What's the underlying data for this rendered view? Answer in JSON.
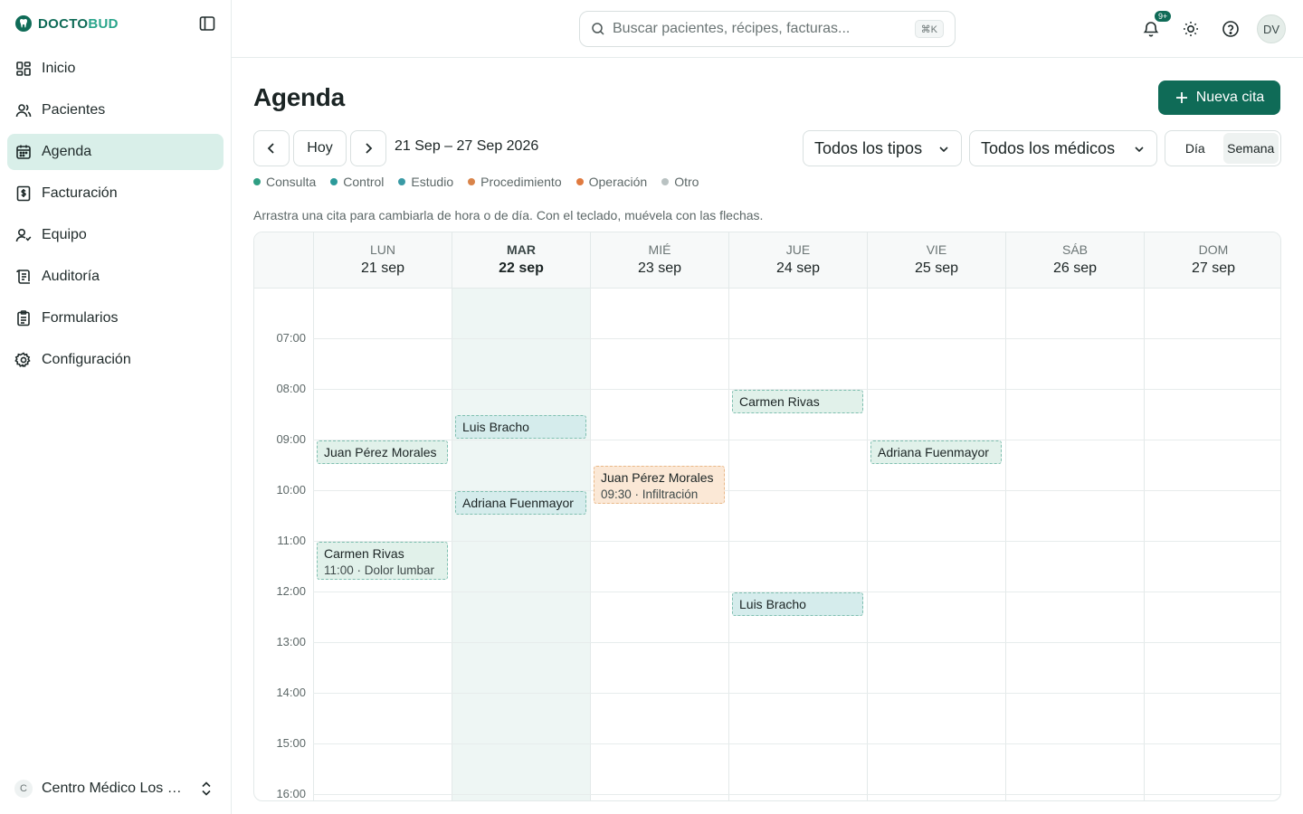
{
  "brand": {
    "name_a": "DOCTO",
    "name_b": "BUD"
  },
  "sidebar": {
    "items": [
      {
        "label": "Inicio",
        "icon": "dashboard-icon"
      },
      {
        "label": "Pacientes",
        "icon": "users-icon"
      },
      {
        "label": "Agenda",
        "icon": "calendar-icon",
        "active": true
      },
      {
        "label": "Facturación",
        "icon": "invoice-icon"
      },
      {
        "label": "Equipo",
        "icon": "team-icon"
      },
      {
        "label": "Auditoría",
        "icon": "audit-icon"
      },
      {
        "label": "Formularios",
        "icon": "forms-icon"
      },
      {
        "label": "Configuración",
        "icon": "settings-icon"
      }
    ],
    "org": {
      "initial": "C",
      "name": "Centro Médico Los O..."
    }
  },
  "topbar": {
    "search_placeholder": "Buscar pacientes, récipes, facturas...",
    "search_shortcut": "⌘K",
    "notifications_badge": "9+",
    "avatar_initials": "DV"
  },
  "page": {
    "title": "Agenda",
    "new_button": "Nueva cita",
    "today_button": "Hoy",
    "range": "21 Sep – 27 Sep 2026",
    "type_filter": "Todos los tipos",
    "doctor_filter": "Todos los médicos",
    "view_day": "Día",
    "view_week": "Semana",
    "hint": "Arrastra una cita para cambiarla de hora o de día. Con el teclado, muévela con las flechas."
  },
  "legend": [
    {
      "label": "Consulta",
      "color": "#2f9e83"
    },
    {
      "label": "Control",
      "color": "#2b9a9a"
    },
    {
      "label": "Estudio",
      "color": "#3a9aa5"
    },
    {
      "label": "Procedimiento",
      "color": "#d9844a"
    },
    {
      "label": "Operación",
      "color": "#e07a3f"
    },
    {
      "label": "Otro",
      "color": "#b9c2c2"
    }
  ],
  "calendar": {
    "days": [
      {
        "dow": "LUN",
        "date": "21 sep"
      },
      {
        "dow": "MAR",
        "date": "22 sep",
        "today": true
      },
      {
        "dow": "MIÉ",
        "date": "23 sep"
      },
      {
        "dow": "JUE",
        "date": "24 sep"
      },
      {
        "dow": "VIE",
        "date": "25 sep"
      },
      {
        "dow": "SÁB",
        "date": "26 sep"
      },
      {
        "dow": "DOM",
        "date": "27 sep"
      }
    ],
    "hours": [
      "07:00",
      "08:00",
      "09:00",
      "10:00",
      "11:00",
      "12:00",
      "13:00",
      "14:00",
      "15:00",
      "16:00"
    ],
    "appointments": [
      {
        "day": 0,
        "start": "09:00",
        "end": "09:30",
        "patient": "Juan Pérez Morales",
        "type": "consulta"
      },
      {
        "day": 0,
        "start": "11:00",
        "end": "11:45",
        "patient": "Carmen Rivas",
        "detail": "11:00 · Dolor lumbar",
        "type": "consulta"
      },
      {
        "day": 1,
        "start": "08:30",
        "end": "09:00",
        "patient": "Luis Bracho",
        "type": "control"
      },
      {
        "day": 1,
        "start": "10:00",
        "end": "10:30",
        "patient": "Adriana Fuenmayor",
        "type": "control"
      },
      {
        "day": 2,
        "start": "09:30",
        "end": "10:15",
        "patient": "Juan Pérez Morales",
        "detail": "09:30 · Infiltración",
        "type": "procedimiento"
      },
      {
        "day": 3,
        "start": "08:00",
        "end": "08:30",
        "patient": "Carmen Rivas",
        "type": "consulta"
      },
      {
        "day": 3,
        "start": "12:00",
        "end": "12:30",
        "patient": "Luis Bracho",
        "type": "control"
      },
      {
        "day": 4,
        "start": "09:00",
        "end": "09:30",
        "patient": "Adriana Fuenmayor",
        "type": "consulta"
      }
    ]
  }
}
